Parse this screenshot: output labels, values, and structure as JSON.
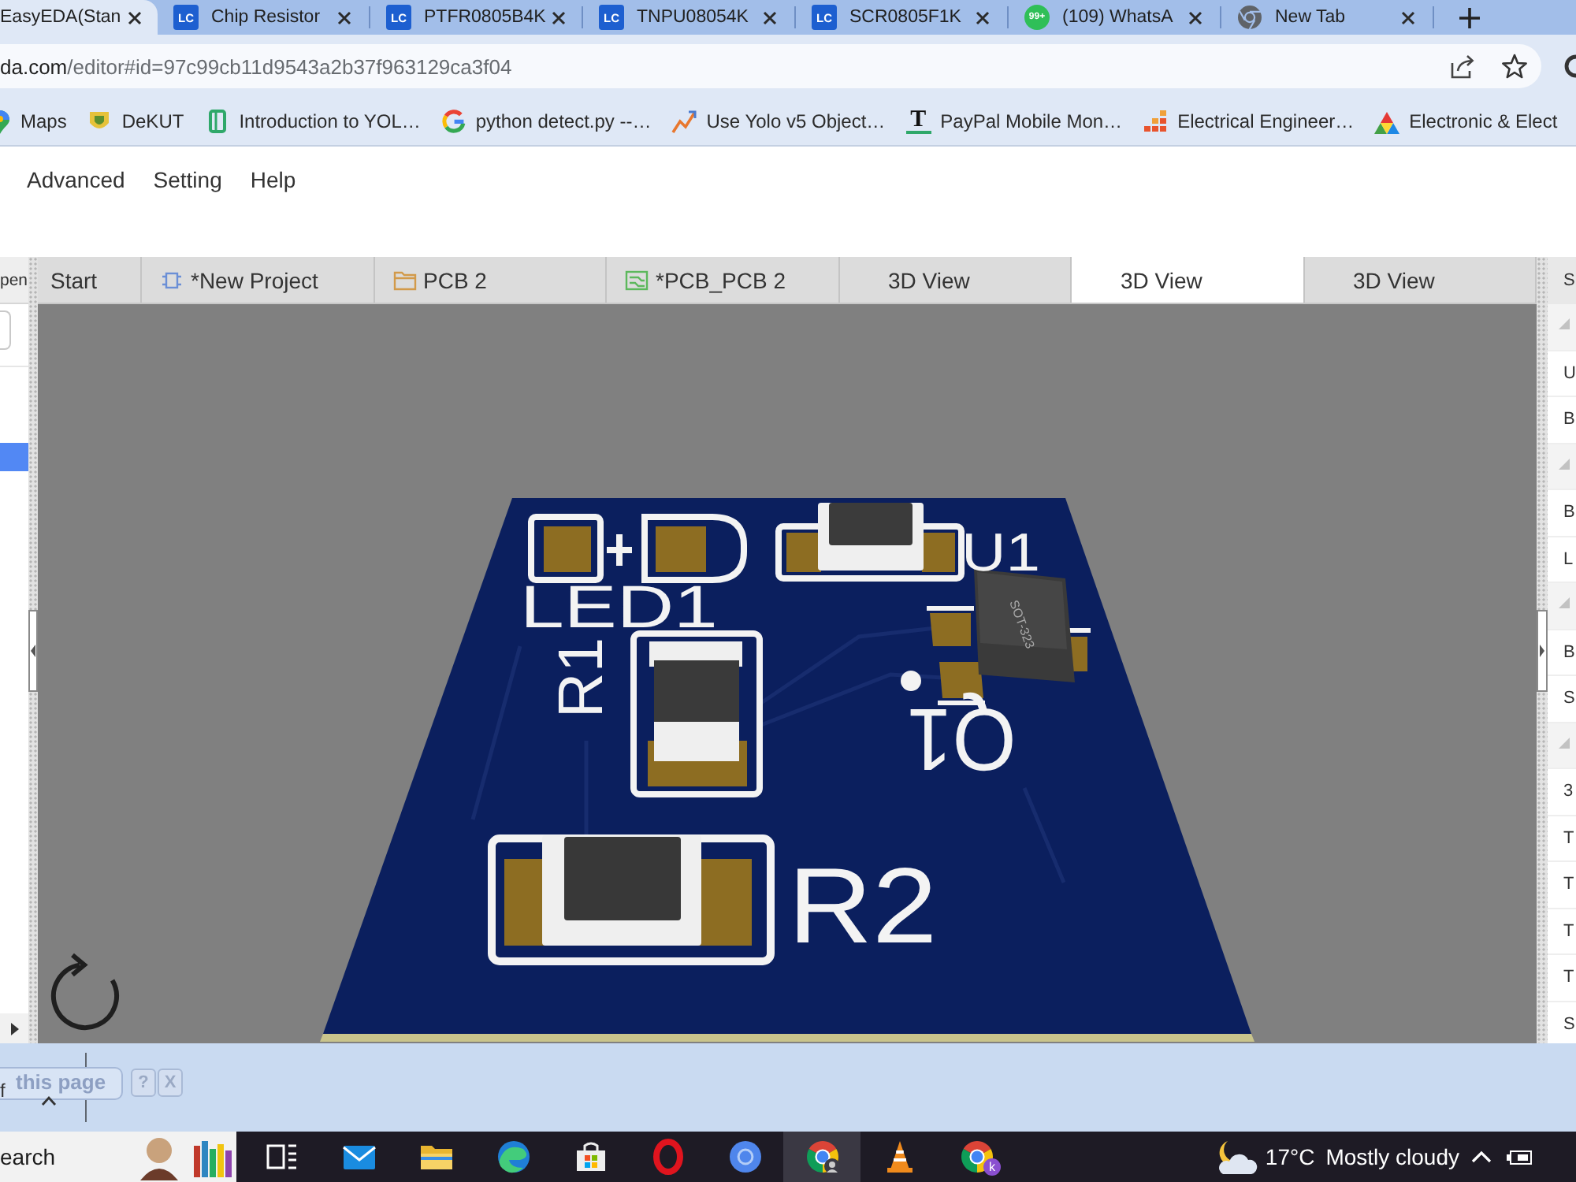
{
  "browser": {
    "tabs": [
      {
        "title": "EasyEDA(Stan",
        "selected": true
      },
      {
        "title": "Chip Resistor",
        "kind": "lc",
        "icon_text": "LC",
        "selected": false
      },
      {
        "title": "PTFR0805B4K",
        "kind": "lc",
        "icon_text": "LC",
        "selected": false
      },
      {
        "title": "TNPU08054K",
        "kind": "lc",
        "icon_text": "LC",
        "selected": false
      },
      {
        "title": "SCR0805F1K",
        "kind": "lc",
        "icon_text": "LC",
        "selected": false
      },
      {
        "title": "(109) WhatsA",
        "kind": "chat",
        "icon_text": "99+",
        "selected": false
      },
      {
        "title": "New Tab",
        "kind": "chrome",
        "selected": false
      }
    ],
    "address": {
      "host": "da.com",
      "path": "/editor#id=97c99cb11d9543a2b37f963129ca3f04"
    },
    "bookmarks": [
      {
        "label": "Maps",
        "kind": "map"
      },
      {
        "label": "DeKUT",
        "kind": "crest"
      },
      {
        "label": "Introduction to YOL…",
        "kind": "book"
      },
      {
        "label": "python detect.py --…",
        "kind": "google"
      },
      {
        "label": "Use Yolo v5 Object…",
        "kind": "chart"
      },
      {
        "label": "PayPal Mobile Mon…",
        "kind": "letter",
        "icon_text": "T"
      },
      {
        "label": "Electrical Engineer…",
        "kind": "blocks"
      },
      {
        "label": "Electronic & Elect",
        "kind": "peaks"
      }
    ]
  },
  "menu": [
    "Advanced",
    "Setting",
    "Help"
  ],
  "left_panel": {
    "title": "pen",
    "rows": [
      {
        "selected": true
      }
    ]
  },
  "doc_tabs": [
    {
      "label": "Start",
      "selected": false
    },
    {
      "label": "*New Project",
      "kind": "project",
      "selected": false
    },
    {
      "label": "PCB 2",
      "kind": "folder",
      "selected": false
    },
    {
      "label": "*PCB_PCB 2",
      "kind": "pcb",
      "selected": false
    },
    {
      "label": "3D View",
      "selected": false
    },
    {
      "label": "3D View",
      "selected": true
    },
    {
      "label": "3D View",
      "selected": false
    }
  ],
  "board": {
    "labels": [
      "LED1",
      "U1",
      "R1",
      "Q1",
      "R2"
    ],
    "chip_marking": "SOT-323"
  },
  "right_panel": {
    "title": "S",
    "groups": [
      {
        "expanded": true,
        "items": [
          "U",
          "B"
        ]
      },
      {
        "expanded": true,
        "items": [
          "B",
          "L"
        ]
      },
      {
        "expanded": true,
        "items": [
          "B",
          "S"
        ]
      },
      {
        "expanded": true,
        "items": [
          "3",
          "T",
          "T",
          "T",
          "T",
          "S"
        ]
      }
    ]
  },
  "bottom_panel": {
    "cut_text": "f",
    "prompt": "this page",
    "help": "?",
    "close": "X"
  },
  "taskbar": {
    "search": "earch",
    "apps": [
      {
        "kind": "task-view",
        "selected": false
      },
      {
        "kind": "mail",
        "selected": false
      },
      {
        "kind": "folder",
        "selected": false
      },
      {
        "kind": "edge",
        "selected": false
      },
      {
        "kind": "store",
        "selected": false
      },
      {
        "kind": "opera",
        "selected": false
      },
      {
        "kind": "chromium",
        "selected": false
      },
      {
        "kind": "chrome",
        "selected": true
      },
      {
        "kind": "cone",
        "selected": false
      },
      {
        "kind": "chrome-profile",
        "icon_text": "k",
        "selected": false
      }
    ],
    "weather": {
      "temperature": "17°C",
      "condition": "Mostly cloudy"
    }
  }
}
